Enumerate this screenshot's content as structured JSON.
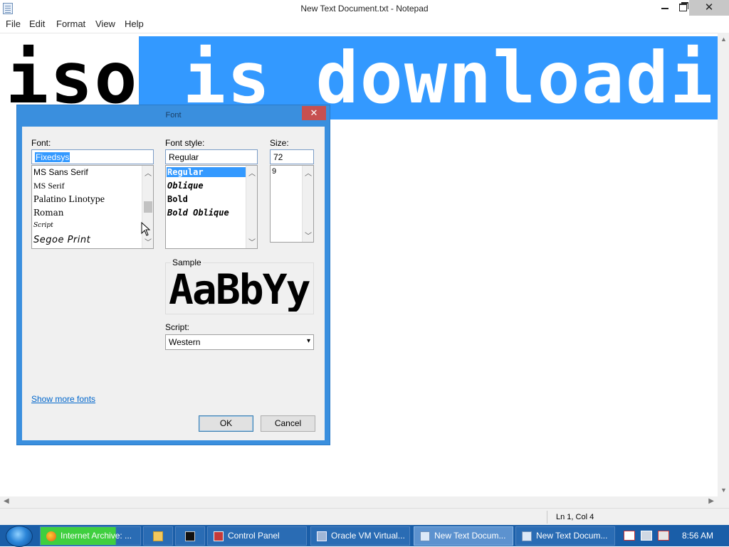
{
  "window": {
    "title": "New Text Document.txt - Notepad",
    "close_glyph": "✕"
  },
  "menu": [
    "File",
    "Edit",
    "Format",
    "View",
    "Help"
  ],
  "editor": {
    "text_unselected": "iso",
    "text_selected": " is downloading"
  },
  "status": {
    "position": "Ln 1, Col 4"
  },
  "font_dialog": {
    "title": "Font",
    "close_glyph": "✕",
    "font_label": "Font:",
    "font_value": "Fixedsys",
    "font_list": [
      "MS Sans Serif",
      "MS Serif",
      "Palatino Linotype",
      "Roman",
      "Script",
      "Segoe Print"
    ],
    "style_label": "Font style:",
    "style_value": "Regular",
    "style_list": [
      "Regular",
      "Oblique",
      "Bold",
      "Bold Oblique"
    ],
    "size_label": "Size:",
    "size_value": "72",
    "size_list": [
      "9"
    ],
    "sample_label": "Sample",
    "sample_text": "AaBbYy",
    "script_label": "Script:",
    "script_value": "Western",
    "show_more": "Show more fonts",
    "ok": "OK",
    "cancel": "Cancel"
  },
  "taskbar": {
    "items": [
      "Internet Archive: ...",
      "Control Panel",
      "Oracle VM Virtual...",
      "New Text Docum...",
      "New Text Docum..."
    ],
    "clock": "8:56 AM"
  },
  "colors": {
    "selection": "#3399ff",
    "dialog_frame": "#3a8fde",
    "taskbar": "#1a5ea8"
  },
  "icons": [
    "notepad-icon",
    "minimize-icon",
    "maximize-icon",
    "close-icon",
    "firefox-icon",
    "file-explorer-icon",
    "cmd-icon",
    "control-panel-icon",
    "virtualbox-icon",
    "notepad-task-icon",
    "action-center-icon",
    "network-icon",
    "volume-muted-icon"
  ]
}
